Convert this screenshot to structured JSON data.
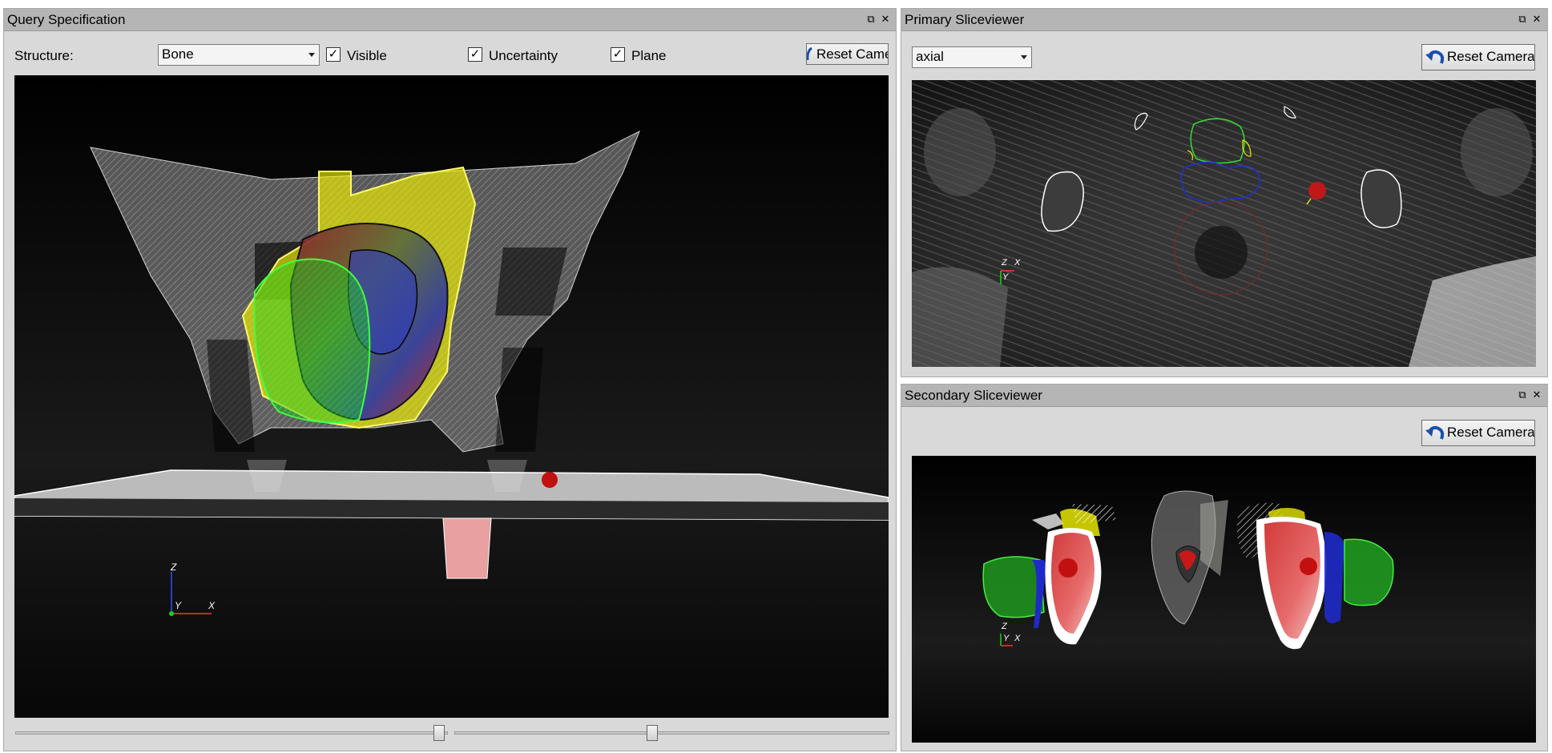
{
  "query_panel": {
    "title": "Query Specification",
    "structure_label": "Structure:",
    "structure_value": "Bone",
    "visible_label": "Visible",
    "visible_checked": true,
    "uncertainty_label": "Uncertainty",
    "uncertainty_checked": true,
    "plane_label": "Plane",
    "plane_checked": true,
    "reset_label": "Reset Camera",
    "axis_labels": {
      "z": "Z",
      "y": "Y",
      "x": "X"
    },
    "slider_left_value": 0.49,
    "slider_right_value": 0.46
  },
  "primary_panel": {
    "title": "Primary Sliceviewer",
    "view_value": "axial",
    "reset_label": "Reset Camera",
    "axis_labels": {
      "z": "Z",
      "y": "Y",
      "x": "X"
    }
  },
  "secondary_panel": {
    "title": "Secondary Sliceviewer",
    "reset_label": "Reset Camera",
    "axis_labels": {
      "z": "Z",
      "y": "Y",
      "x": "X"
    }
  },
  "icons": {
    "float": "restore-window-icon",
    "close": "close-icon",
    "reset": "reset-camera-icon"
  },
  "colors": {
    "titlebar": "#b5b5b5",
    "panel": "#d9d9d9",
    "bone": "#b8b8b8",
    "uncertainty_yellow": "#f2f200",
    "uncertainty_green": "#22cc22",
    "blue": "#1e2ac8",
    "red": "#d01818"
  }
}
